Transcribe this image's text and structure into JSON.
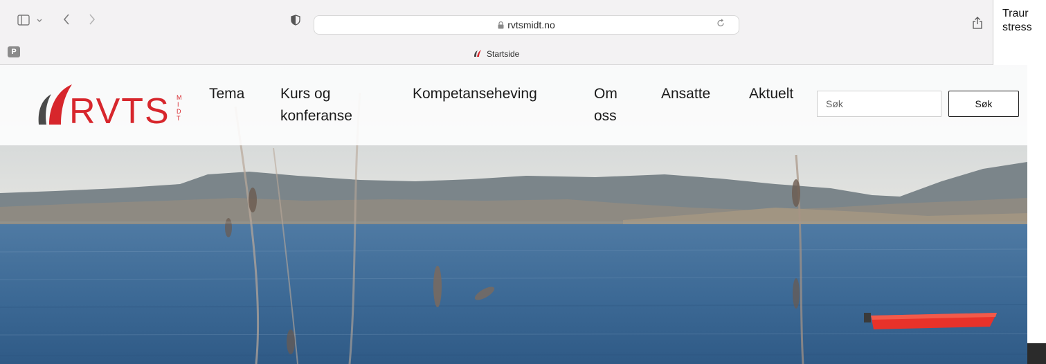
{
  "browser": {
    "url": "rvtsmidt.no",
    "tab_title": "Startside",
    "pinned_badge": "P",
    "icons": [
      "sidebar-icon",
      "chevron-down-icon",
      "back-icon",
      "forward-icon",
      "shield-icon",
      "lock-icon",
      "reload-icon",
      "share-icon"
    ]
  },
  "side_panel": {
    "line1": "Traur",
    "line2": "stress"
  },
  "site": {
    "logo_text": "RVTS",
    "logo_sub": "MIDT",
    "nav": [
      {
        "label": "Tema"
      },
      {
        "label": "Kurs og konferanse"
      },
      {
        "label": "Kompetanseheving"
      },
      {
        "label": "Om oss"
      },
      {
        "label": "Ansatte"
      },
      {
        "label": "Aktuelt"
      }
    ],
    "search": {
      "placeholder": "Søk",
      "button_label": "Søk"
    }
  },
  "colors": {
    "brand_red": "#d7262c",
    "chrome_bg": "#f3f2f3",
    "sea": "#3f6c98",
    "sky": "#dfe3e4",
    "boat": "#e8322a"
  }
}
